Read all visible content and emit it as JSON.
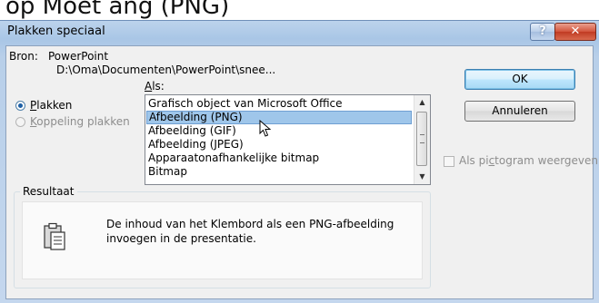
{
  "background_text": "op  Moet ang (PNG)",
  "window": {
    "title": "Plakken speciaal",
    "help_label": "?",
    "close_label": "✕"
  },
  "source": {
    "label": "Bron:",
    "app": "PowerPoint",
    "path": "D:\\Oma\\Documenten\\PowerPoint\\snee..."
  },
  "as": {
    "label_underlined": "A",
    "label_rest": "ls:",
    "items": [
      "Grafisch object van Microsoft Office",
      "Afbeelding (PNG)",
      "Afbeelding (GIF)",
      "Afbeelding (JPEG)",
      "Apparaatonafhankelijke bitmap",
      "Bitmap"
    ],
    "selected_index": 1
  },
  "options": {
    "paste_u": "P",
    "paste_rest": "lakken",
    "paste_selected": true,
    "link_u": "K",
    "link_rest": "oppeling plakken",
    "link_enabled": false
  },
  "buttons": {
    "ok": "OK",
    "cancel": "Annuleren"
  },
  "icon_checkbox": {
    "pre": "Als pi",
    "u": "c",
    "post": "togram weergeven",
    "checked": false,
    "enabled": false
  },
  "result": {
    "label": "Resultaat",
    "line1": "De inhoud van het Klembord als een PNG-afbeelding",
    "line2": "invoegen in de presentatie."
  },
  "colors": {
    "selection": "#9fc6ea",
    "titlebar": "#b8cfe9",
    "close": "#c8472e"
  },
  "icons": [
    "help-icon",
    "close-icon",
    "clipboard-icon",
    "mouse-pointer-icon",
    "scroll-up-icon",
    "scroll-down-icon"
  ]
}
